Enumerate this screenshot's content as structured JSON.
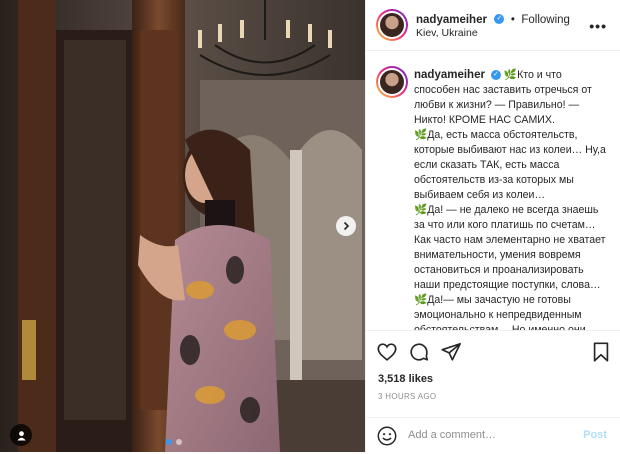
{
  "post": {
    "username": "nadyameiher",
    "follow_status": "Following",
    "separator": "•",
    "location": "Kiev, Ukraine",
    "verified": true
  },
  "caption": {
    "username": "nadyameiher",
    "lines": [
      "Кто и что способен нас заставить отречься от любви к жизни? — Правильно! —Никто! КРОМЕ НАС САМИХ.",
      "Да, есть масса обстоятельств, которые выбивают нас из колеи… Ну,а если сказать ТАК, есть масса обстоятельств из-за которых мы выбиваем себя из колеи…",
      "Да! — не далеко не всегда знаешь за что или кого платишь по счетам… Как часто нам элементарно не хватает внимательности, умения вовремя остановиться и проанализировать наши предстоящие поступки, слова…",
      "Да!— мы зачастую не готовы эмоционально к непредвиденным обстоятельствам… Но именно они."
    ]
  },
  "stats": {
    "likes": "3,518 likes",
    "time": "3 HOURS AGO"
  },
  "comment": {
    "placeholder": "Add a comment…",
    "post_label": "Post"
  },
  "carousel": {
    "active_index": 0,
    "count": 2
  },
  "colors": {
    "verified": "#3897f0",
    "post_disabled": "#b2dffc",
    "leaf_emoji": "#6aa84f"
  },
  "icons": [
    "heart-icon",
    "comment-icon",
    "share-icon",
    "bookmark-icon",
    "more-icon",
    "emoji-icon",
    "chevron-right-icon",
    "user-tag-icon"
  ]
}
